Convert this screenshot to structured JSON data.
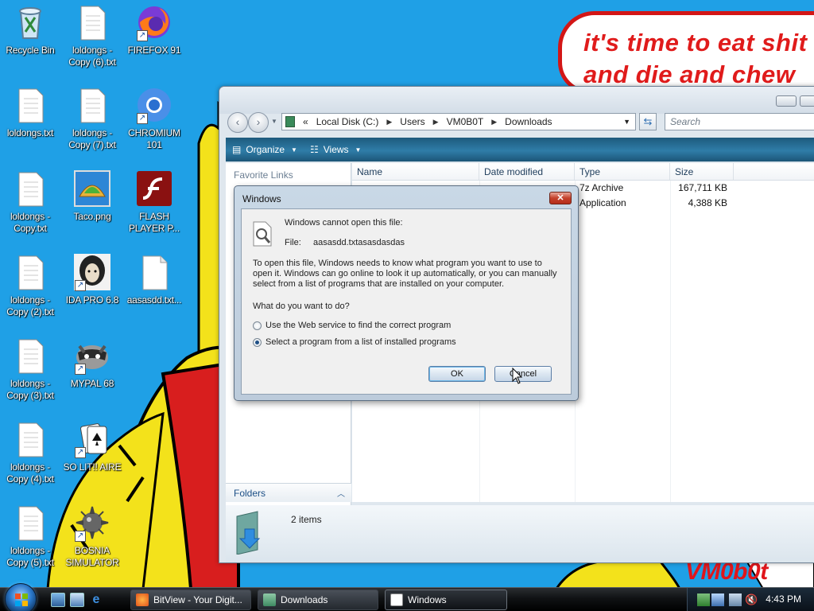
{
  "wallpaper": {
    "speech_line1": "it's time to eat shit",
    "speech_line2": "and die and chew",
    "signature": "VM0b0t"
  },
  "desktop": {
    "icons": [
      {
        "label": "Recycle Bin",
        "icon": "recycle-bin-icon"
      },
      {
        "label": "loldongs - Copy (6).txt",
        "icon": "text-file-icon"
      },
      {
        "label": "FIREFOX 91",
        "icon": "firefox-icon"
      },
      {
        "label": "loldongs.txt",
        "icon": "text-file-icon"
      },
      {
        "label": "loldongs - Copy (7).txt",
        "icon": "text-file-icon"
      },
      {
        "label": "CHROMIUM 101",
        "icon": "chromium-icon"
      },
      {
        "label": "loldongs - Copy.txt",
        "icon": "text-file-icon"
      },
      {
        "label": "Taco.png",
        "icon": "taco-image-icon"
      },
      {
        "label": "FLASH PLAYER P...",
        "icon": "flash-player-icon"
      },
      {
        "label": "loldongs - Copy (2).txt",
        "icon": "text-file-icon"
      },
      {
        "label": "IDA PRO 6.8",
        "icon": "ida-pro-icon"
      },
      {
        "label": "aasasdd.txt...",
        "icon": "blank-file-icon"
      },
      {
        "label": "loldongs - Copy (3).txt",
        "icon": "text-file-icon"
      },
      {
        "label": "MYPAL 68",
        "icon": "mypal-raccoon-icon"
      },
      {
        "label": "loldongs - Copy (4).txt",
        "icon": "text-file-icon"
      },
      {
        "label": "SO LIT!! AIRE",
        "icon": "solitaire-icon"
      },
      {
        "label": "loldongs - Copy (5).txt",
        "icon": "text-file-icon"
      },
      {
        "label": "BOSNIA SIMULATOR",
        "icon": "bosnia-simulator-icon"
      }
    ]
  },
  "explorer": {
    "breadcrumb": [
      "«",
      "Local Disk (C:)",
      "Users",
      "VM0B0T",
      "Downloads"
    ],
    "search_placeholder": "Search",
    "toolbar": {
      "organize": "Organize",
      "views": "Views"
    },
    "favorite_links": "Favorite Links",
    "folders": "Folders",
    "columns": [
      "Name",
      "Date modified",
      "Type",
      "Size"
    ],
    "files": [
      {
        "type": "7z Archive",
        "size": "167,711 KB"
      },
      {
        "type": "Application",
        "size": "4,388 KB"
      }
    ],
    "item_count": "2 items"
  },
  "dialog": {
    "title": "Windows",
    "heading": "Windows cannot open this file:",
    "file_label": "File:",
    "file_name": "aasasdd.txtasasdasdas",
    "explanation_1": "To open this file, Windows needs to know what program you want to use to",
    "explanation_2": "open it.  Windows can go online to look it up automatically, or you can manually",
    "explanation_3": "select from a list of programs that are installed on your computer.",
    "question": "What do you want to do?",
    "option_web": "Use the Web service to find the correct program",
    "option_list": "Select a program from a list of installed programs",
    "selected_option": "option_list",
    "ok": "OK",
    "cancel": "Cancel"
  },
  "taskbar": {
    "buttons": [
      {
        "label": "BitView - Your Digit...",
        "icon": "firefox-icon"
      },
      {
        "label": "Downloads",
        "icon": "folder-icon"
      },
      {
        "label": "Windows",
        "icon": "window-icon"
      }
    ],
    "clock": "4:43 PM"
  },
  "colors": {
    "desktop_bg": "#1fa0e6",
    "speech_text": "#e01b1b",
    "toolbar_bg": "#2f7da8"
  }
}
